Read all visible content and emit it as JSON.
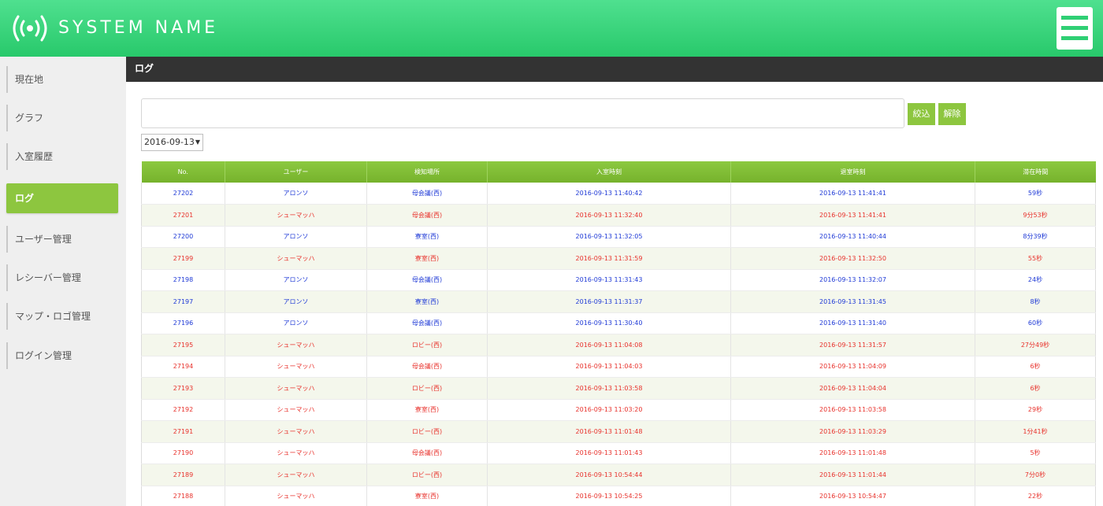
{
  "header": {
    "system_name": "SYSTEM NAME",
    "logo_icon": "wireless-signal-icon",
    "menu_icon": "hamburger-menu-icon",
    "color": "#2fcf74"
  },
  "sidebar": {
    "items": [
      {
        "label": "現在地",
        "active": false
      },
      {
        "label": "グラフ",
        "active": false
      },
      {
        "label": "入室履歴",
        "active": false
      },
      {
        "label": "ログ",
        "active": true
      },
      {
        "label": "ユーザー管理",
        "active": false
      },
      {
        "label": "レシーバー管理",
        "active": false
      },
      {
        "label": "マップ・ロゴ管理",
        "active": false
      },
      {
        "label": "ログイン管理",
        "active": false
      }
    ],
    "active_color": "#8dc63f"
  },
  "page": {
    "title": "ログ"
  },
  "filter": {
    "search_value": "",
    "filter_label": "絞込",
    "clear_label": "解除",
    "date_value": "2016-09-13"
  },
  "table": {
    "columns": [
      "No.",
      "ユーザー",
      "検知場所",
      "入室時刻",
      "退室時刻",
      "滞在時間"
    ],
    "rows": [
      {
        "no": "27202",
        "user": "アロンソ",
        "place": "母会議(西)",
        "enter": "2016-09-13 11:40:42",
        "exit": "2016-09-13 11:41:41",
        "stay": "59秒",
        "color": "blue"
      },
      {
        "no": "27201",
        "user": "シューマッハ",
        "place": "母会議(西)",
        "enter": "2016-09-13 11:32:40",
        "exit": "2016-09-13 11:41:41",
        "stay": "9分53秒",
        "color": "red"
      },
      {
        "no": "27200",
        "user": "アロンソ",
        "place": "寮室(西)",
        "enter": "2016-09-13 11:32:05",
        "exit": "2016-09-13 11:40:44",
        "stay": "8分39秒",
        "color": "blue"
      },
      {
        "no": "27199",
        "user": "シューマッハ",
        "place": "寮室(西)",
        "enter": "2016-09-13 11:31:59",
        "exit": "2016-09-13 11:32:50",
        "stay": "55秒",
        "color": "red"
      },
      {
        "no": "27198",
        "user": "アロンソ",
        "place": "母会議(西)",
        "enter": "2016-09-13 11:31:43",
        "exit": "2016-09-13 11:32:07",
        "stay": "24秒",
        "color": "blue"
      },
      {
        "no": "27197",
        "user": "アロンソ",
        "place": "寮室(西)",
        "enter": "2016-09-13 11:31:37",
        "exit": "2016-09-13 11:31:45",
        "stay": "8秒",
        "color": "blue"
      },
      {
        "no": "27196",
        "user": "アロンソ",
        "place": "母会議(西)",
        "enter": "2016-09-13 11:30:40",
        "exit": "2016-09-13 11:31:40",
        "stay": "60秒",
        "color": "blue"
      },
      {
        "no": "27195",
        "user": "シューマッハ",
        "place": "ロビー(西)",
        "enter": "2016-09-13 11:04:08",
        "exit": "2016-09-13 11:31:57",
        "stay": "27分49秒",
        "color": "red"
      },
      {
        "no": "27194",
        "user": "シューマッハ",
        "place": "母会議(西)",
        "enter": "2016-09-13 11:04:03",
        "exit": "2016-09-13 11:04:09",
        "stay": "6秒",
        "color": "red"
      },
      {
        "no": "27193",
        "user": "シューマッハ",
        "place": "ロビー(西)",
        "enter": "2016-09-13 11:03:58",
        "exit": "2016-09-13 11:04:04",
        "stay": "6秒",
        "color": "red"
      },
      {
        "no": "27192",
        "user": "シューマッハ",
        "place": "寮室(西)",
        "enter": "2016-09-13 11:03:20",
        "exit": "2016-09-13 11:03:58",
        "stay": "29秒",
        "color": "red"
      },
      {
        "no": "27191",
        "user": "シューマッハ",
        "place": "ロビー(西)",
        "enter": "2016-09-13 11:01:48",
        "exit": "2016-09-13 11:03:29",
        "stay": "1分41秒",
        "color": "red"
      },
      {
        "no": "27190",
        "user": "シューマッハ",
        "place": "母会議(西)",
        "enter": "2016-09-13 11:01:43",
        "exit": "2016-09-13 11:01:48",
        "stay": "5秒",
        "color": "red"
      },
      {
        "no": "27189",
        "user": "シューマッハ",
        "place": "ロビー(西)",
        "enter": "2016-09-13 10:54:44",
        "exit": "2016-09-13 11:01:44",
        "stay": "7分0秒",
        "color": "red"
      },
      {
        "no": "27188",
        "user": "シューマッハ",
        "place": "寮室(西)",
        "enter": "2016-09-13 10:54:25",
        "exit": "2016-09-13 10:54:47",
        "stay": "22秒",
        "color": "red"
      }
    ]
  }
}
